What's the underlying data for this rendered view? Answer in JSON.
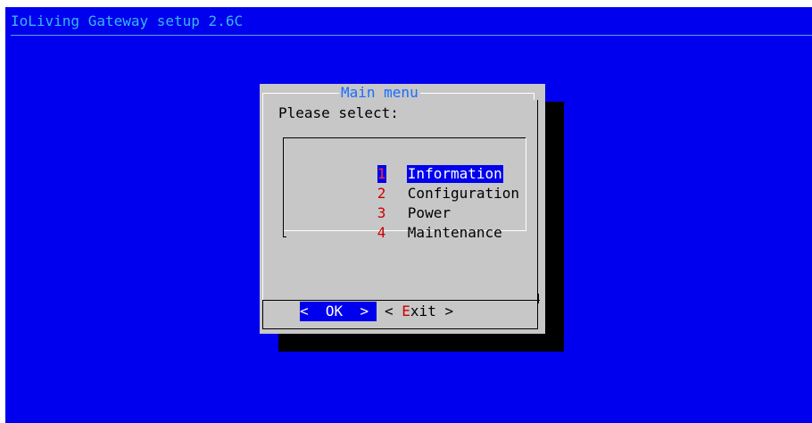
{
  "window": {
    "title": "IoLiving Gateway setup 2.6C"
  },
  "dialog": {
    "title": "Main menu",
    "prompt": "Please select:",
    "items": [
      {
        "key": "1",
        "label": "Information",
        "selected": true
      },
      {
        "key": "2",
        "label": "Configuration",
        "selected": false
      },
      {
        "key": "3",
        "label": "Power",
        "selected": false
      },
      {
        "key": "4",
        "label": "Maintenance",
        "selected": false
      }
    ],
    "buttons": {
      "ok": {
        "left": "<",
        "label": "OK",
        "right": ">",
        "focused": true
      },
      "exit": {
        "left": "<",
        "hotkey": "E",
        "rest": "xit",
        "right": ">",
        "focused": false
      }
    }
  },
  "colors": {
    "screen_background": "#0000ee",
    "dialog_background": "#c7c7c7",
    "highlight": "#0000ee",
    "hotkey": "#cc0000",
    "title_text": "#36b8f2",
    "dialog_title_text": "#1a6dff"
  }
}
